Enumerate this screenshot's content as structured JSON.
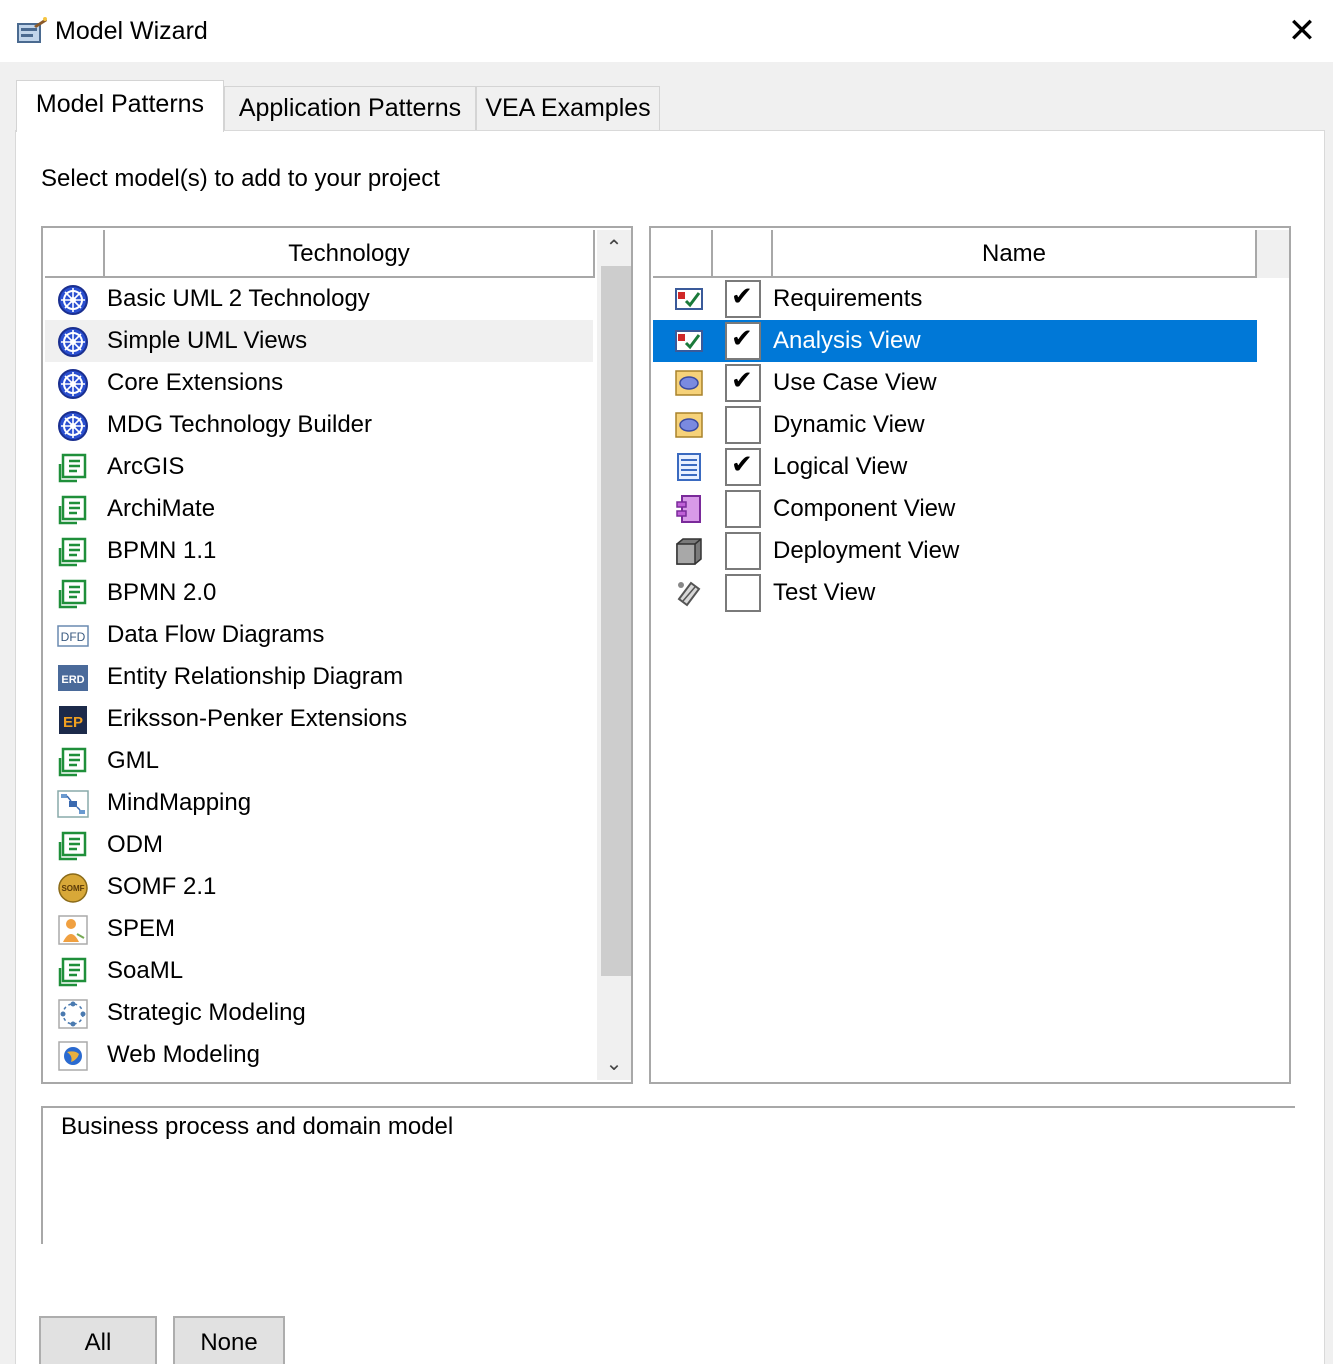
{
  "window": {
    "title": "Model Wizard",
    "close_glyph": "✕"
  },
  "tabs": [
    {
      "label": "Model Patterns",
      "active": true
    },
    {
      "label": "Application Patterns",
      "active": false
    },
    {
      "label": "VEA Examples",
      "active": false
    }
  ],
  "instruction": "Select model(s) to add to your project",
  "technology_list": {
    "header": "Technology",
    "selected_index": 1,
    "items": [
      {
        "label": "Basic UML 2 Technology",
        "icon": "uml-globe-icon"
      },
      {
        "label": "Simple UML Views",
        "icon": "uml-globe-icon"
      },
      {
        "label": "Core Extensions",
        "icon": "uml-globe-icon"
      },
      {
        "label": "MDG Technology Builder",
        "icon": "uml-globe-icon"
      },
      {
        "label": "ArcGIS",
        "icon": "mdg-technology-icon"
      },
      {
        "label": "ArchiMate",
        "icon": "mdg-technology-icon"
      },
      {
        "label": "BPMN 1.1",
        "icon": "mdg-technology-icon"
      },
      {
        "label": "BPMN 2.0",
        "icon": "mdg-technology-icon"
      },
      {
        "label": "Data Flow Diagrams",
        "icon": "dfd-icon"
      },
      {
        "label": "Entity Relationship Diagram",
        "icon": "erd-icon"
      },
      {
        "label": "Eriksson-Penker Extensions",
        "icon": "ep-icon"
      },
      {
        "label": "GML",
        "icon": "mdg-technology-icon"
      },
      {
        "label": "MindMapping",
        "icon": "mindmap-icon"
      },
      {
        "label": "ODM",
        "icon": "mdg-technology-icon"
      },
      {
        "label": "SOMF 2.1",
        "icon": "somf-icon"
      },
      {
        "label": "SPEM",
        "icon": "spem-icon"
      },
      {
        "label": "SoaML",
        "icon": "mdg-technology-icon"
      },
      {
        "label": "Strategic Modeling",
        "icon": "strategic-icon"
      },
      {
        "label": "Web Modeling",
        "icon": "web-icon"
      }
    ],
    "icon_texts": {
      "dfd": "DFD",
      "erd": "ERD",
      "ep": "EP",
      "somf": "SOMF"
    }
  },
  "name_list": {
    "header": "Name",
    "selected_index": 1,
    "check_glyph": "✔",
    "items": [
      {
        "label": "Requirements",
        "checked": true,
        "icon": "requirements-icon"
      },
      {
        "label": "Analysis View",
        "checked": true,
        "icon": "requirements-icon"
      },
      {
        "label": "Use Case View",
        "checked": true,
        "icon": "use-case-icon"
      },
      {
        "label": "Dynamic View",
        "checked": false,
        "icon": "use-case-icon"
      },
      {
        "label": "Logical View",
        "checked": true,
        "icon": "logical-icon"
      },
      {
        "label": "Component View",
        "checked": false,
        "icon": "component-icon"
      },
      {
        "label": "Deployment View",
        "checked": false,
        "icon": "deployment-icon"
      },
      {
        "label": "Test View",
        "checked": false,
        "icon": "test-icon"
      }
    ]
  },
  "description": "Business process and domain model",
  "buttons": {
    "all": "All",
    "none": "None"
  },
  "scroll_glyphs": {
    "up": "⌃",
    "down": "⌄"
  },
  "colors": {
    "selection_blue": "#0078d7",
    "selection_gray": "#f0f0f0"
  }
}
